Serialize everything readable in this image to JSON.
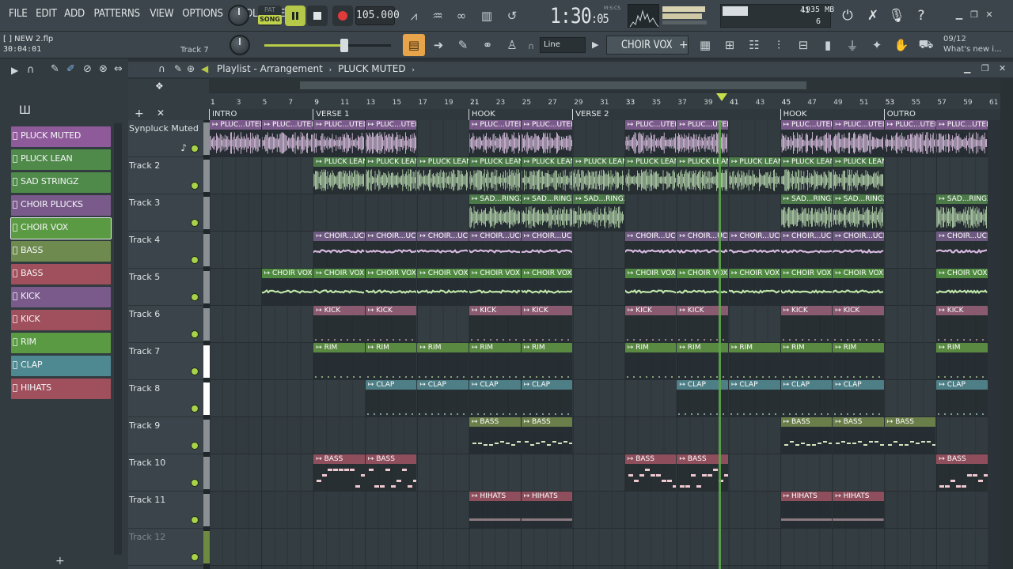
{
  "menus": [
    "FILE",
    "EDIT",
    "ADD",
    "PATTERNS",
    "VIEW",
    "OPTIONS",
    "TOOLS",
    "HELP"
  ],
  "transport": {
    "pat": "PAT",
    "song": "SONG",
    "tempo": "105.000",
    "time_main": "1:30",
    "time_sub": "05",
    "time_unit": "M:S:CS"
  },
  "cpu": {
    "num1": "41",
    "mem": "1935 MB",
    "num2": "6"
  },
  "project": {
    "file": "[  ] NEW 2.flp",
    "time": "30:04:01",
    "track": "Track 7"
  },
  "snap_mode": "Line",
  "instrument": "CHOIR VOX",
  "hint": {
    "date": "09/12",
    "text": "What's new i..."
  },
  "playlist": {
    "title": "Playlist - Arrangement",
    "pattern": "PLUCK MUTED"
  },
  "channels": [
    {
      "label": "PLUCK MUTED",
      "color": "#8f5a9a"
    },
    {
      "label": "PLUCK LEAN",
      "color": "#4f8a4a"
    },
    {
      "label": "SAD STRINGZ",
      "color": "#4f8a4a"
    },
    {
      "label": "CHOIR PLUCKS",
      "color": "#7a5a8a"
    },
    {
      "label": "CHOIR VOX",
      "color": "#5a9a42"
    },
    {
      "label": "BASS",
      "color": "#6e8a4e"
    },
    {
      "label": "BASS",
      "color": "#a0505c"
    },
    {
      "label": "KICK",
      "color": "#7a5a8a"
    },
    {
      "label": "KICK",
      "color": "#a0505c"
    },
    {
      "label": "RIM",
      "color": "#5a9a42"
    },
    {
      "label": "CLAP",
      "color": "#4e8890"
    },
    {
      "label": "HIHATS",
      "color": "#a0505c"
    }
  ],
  "ruler_ticks": [
    "1",
    "3",
    "5",
    "7",
    "9",
    "11",
    "13",
    "15",
    "17",
    "19",
    "21",
    "23",
    "25",
    "27",
    "29",
    "31",
    "33",
    "35",
    "37",
    "39",
    "41",
    "43",
    "45",
    "47",
    "49",
    "51",
    "53",
    "55",
    "57",
    "59",
    "61"
  ],
  "markers": [
    {
      "label": "INTRO",
      "bar": 1
    },
    {
      "label": "VERSE 1",
      "bar": 9
    },
    {
      "label": "HOOK",
      "bar": 21
    },
    {
      "label": "VERSE 2",
      "bar": 29
    },
    {
      "label": "HOOK",
      "bar": 45
    },
    {
      "label": "OUTRO",
      "bar": 53
    }
  ],
  "tracks": [
    {
      "name": "Synpluck Muted"
    },
    {
      "name": "Track 2"
    },
    {
      "name": "Track 3"
    },
    {
      "name": "Track 4"
    },
    {
      "name": "Track 5"
    },
    {
      "name": "Track 6"
    },
    {
      "name": "Track 7"
    },
    {
      "name": "Track 8"
    },
    {
      "name": "Track 9"
    },
    {
      "name": "Track 10"
    },
    {
      "name": "Track 11"
    },
    {
      "name": "Track 12"
    }
  ],
  "clips": [
    {
      "track": 0,
      "label": "PLUC...UTED",
      "starts": [
        1,
        5,
        9,
        13,
        21,
        25,
        33,
        37,
        45,
        49,
        53,
        57
      ],
      "len": 4,
      "color": "#7a5a8a",
      "type": "audio",
      "wave": "#e6c8ec"
    },
    {
      "track": 1,
      "label": "PLUCK LEAN",
      "starts": [
        9,
        13,
        17,
        21,
        25,
        29,
        33,
        37,
        41,
        45,
        49
      ],
      "len": 4,
      "color": "#4b7a48",
      "type": "audio",
      "wave": "#bfe0b4"
    },
    {
      "track": 2,
      "label": "SAD...RINGZ",
      "starts": [
        21,
        25,
        29,
        45,
        49,
        57
      ],
      "len": 4,
      "color": "#4b7a48",
      "type": "audio",
      "wave": "#bfe0b4"
    },
    {
      "track": 3,
      "label": "CHOIR...UCKS",
      "starts": [
        9,
        13,
        17,
        21,
        25,
        33,
        37,
        41,
        45,
        49,
        57
      ],
      "len": 4,
      "color": "#6e5a80",
      "type": "line",
      "wave": "#d7b8e0"
    },
    {
      "track": 4,
      "label": "CHOIR VOX",
      "starts": [
        5,
        9,
        13,
        17,
        21,
        25,
        33,
        37,
        41,
        45,
        49,
        57
      ],
      "len": 4,
      "color": "#4f8a40",
      "type": "line",
      "wave": "#bfe6a8"
    },
    {
      "track": 5,
      "label": "KICK",
      "starts": [
        9,
        13,
        21,
        25,
        33,
        37,
        45,
        49,
        57
      ],
      "len": 4,
      "color": "#8a5a70",
      "type": "notes",
      "wave": "#e4b8c8"
    },
    {
      "track": 6,
      "label": "RIM",
      "starts": [
        9,
        13,
        17,
        21,
        25,
        33,
        37,
        41,
        45,
        49,
        57
      ],
      "len": 4,
      "color": "#5a8a42",
      "type": "notes",
      "wave": "#c8e8a8"
    },
    {
      "track": 7,
      "label": "CLAP",
      "starts": [
        13,
        17,
        21,
        25,
        37,
        41,
        45,
        49,
        57
      ],
      "len": 4,
      "color": "#4e7e86",
      "type": "notes",
      "wave": "#b8dde2"
    },
    {
      "track": 8,
      "label": "BASS",
      "starts": [
        21,
        25,
        45,
        49,
        53
      ],
      "len": 4,
      "color": "#6a7e4a",
      "type": "bass",
      "wave": "#d8e4c0"
    },
    {
      "track": 9,
      "label": "BASS",
      "starts": [
        9,
        13,
        33,
        37,
        57
      ],
      "len": 4,
      "color": "#8e4e5c",
      "type": "bass",
      "wave": "#f0c8d0"
    },
    {
      "track": 10,
      "label": "HIHATS",
      "starts": [
        21,
        25,
        45,
        49
      ],
      "len": 4,
      "color": "#8e4e5c",
      "type": "hat",
      "wave": "#f0c8d0"
    }
  ]
}
